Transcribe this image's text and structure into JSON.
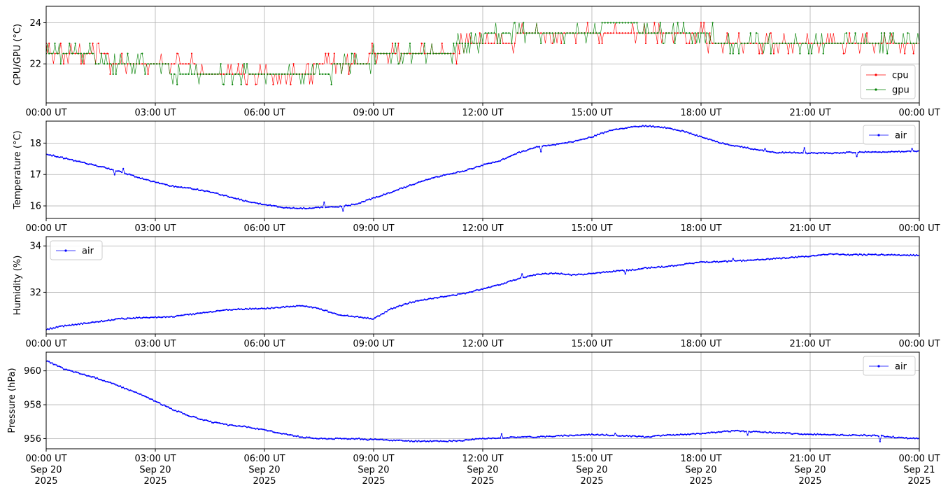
{
  "chart_data": [
    {
      "type": "line",
      "ylabel": "CPU/GPU (°C)",
      "ylim": [
        20.1,
        24.8
      ],
      "yticks": [
        22,
        24
      ],
      "xticks": [
        "00:00 UT",
        "03:00 UT",
        "06:00 UT",
        "09:00 UT",
        "12:00 UT",
        "15:00 UT",
        "18:00 UT",
        "21:00 UT",
        "00:00 UT"
      ],
      "grid": true,
      "legend": "bottom-right",
      "series": [
        {
          "name": "cpu",
          "color": "#ff0000",
          "x_hours": [
            0,
            0.5,
            1,
            1.5,
            2,
            2.5,
            3,
            3.5,
            4,
            4.5,
            5,
            5.5,
            6,
            6.5,
            7,
            7.5,
            8,
            8.5,
            9,
            9.5,
            10,
            10.5,
            11,
            11.5,
            12,
            12.5,
            13,
            13.5,
            14,
            14.5,
            15,
            15.5,
            16,
            16.5,
            17,
            17.5,
            18,
            18.5,
            19,
            19.5,
            20,
            20.5,
            21,
            21.5,
            22,
            22.5,
            23,
            23.5,
            24
          ],
          "values": [
            22.9,
            22.4,
            22.4,
            22.4,
            22.0,
            22.0,
            21.9,
            21.9,
            21.9,
            21.4,
            21.4,
            21.4,
            21.4,
            21.4,
            21.4,
            21.9,
            21.9,
            21.9,
            22.4,
            22.4,
            22.4,
            22.4,
            22.4,
            22.9,
            23.0,
            23.0,
            23.3,
            23.5,
            23.5,
            23.6,
            23.6,
            23.6,
            23.6,
            23.6,
            23.6,
            23.6,
            23.4,
            23.0,
            23.0,
            22.9,
            22.9,
            22.9,
            22.9,
            22.9,
            22.9,
            22.9,
            22.9,
            22.9,
            23.0
          ]
        },
        {
          "name": "gpu",
          "color": "#008000",
          "x_hours": [
            0,
            0.5,
            1,
            1.5,
            2,
            2.5,
            3,
            3.5,
            4,
            4.5,
            5,
            5.5,
            6,
            6.5,
            7,
            7.5,
            8,
            8.5,
            9,
            9.5,
            10,
            10.5,
            11,
            11.5,
            12,
            12.5,
            13,
            13.5,
            14,
            14.5,
            15,
            15.5,
            16,
            16.5,
            17,
            17.5,
            18,
            18.5,
            19,
            19.5,
            20,
            20.5,
            21,
            21.5,
            22,
            22.5,
            23,
            23.5,
            24
          ],
          "values": [
            22.7,
            22.4,
            22.3,
            22.2,
            22.1,
            22.0,
            21.9,
            21.7,
            21.5,
            21.4,
            21.4,
            21.4,
            21.4,
            21.4,
            21.4,
            21.6,
            21.8,
            21.9,
            22.3,
            22.4,
            22.4,
            22.4,
            22.6,
            22.9,
            23.3,
            23.4,
            23.5,
            23.5,
            23.6,
            23.6,
            23.7,
            23.8,
            23.8,
            23.7,
            23.6,
            23.6,
            23.4,
            23.2,
            23.1,
            23.0,
            23.0,
            23.0,
            23.0,
            23.0,
            23.0,
            23.0,
            23.0,
            23.0,
            23.1
          ]
        }
      ]
    },
    {
      "type": "line",
      "ylabel": "Temperature (°C)",
      "ylim": [
        15.6,
        18.7
      ],
      "yticks": [
        16,
        17,
        18
      ],
      "xticks": [
        "00:00 UT",
        "03:00 UT",
        "06:00 UT",
        "09:00 UT",
        "12:00 UT",
        "15:00 UT",
        "18:00 UT",
        "21:00 UT",
        "00:00 UT"
      ],
      "grid": true,
      "legend": "top-right",
      "series": [
        {
          "name": "air",
          "color": "#0000ff",
          "x_hours": [
            0,
            0.5,
            1,
            1.5,
            2,
            2.5,
            3,
            3.5,
            4,
            4.5,
            5,
            5.5,
            6,
            6.5,
            7,
            7.5,
            8,
            8.5,
            9,
            9.5,
            10,
            10.5,
            11,
            11.5,
            12,
            12.5,
            13,
            13.5,
            14,
            14.5,
            15,
            15.5,
            16,
            16.5,
            17,
            17.5,
            18,
            18.5,
            19,
            19.5,
            20,
            20.5,
            21,
            21.5,
            22,
            22.5,
            23,
            23.5,
            24
          ],
          "values": [
            17.65,
            17.52,
            17.38,
            17.25,
            17.1,
            16.92,
            16.75,
            16.62,
            16.55,
            16.45,
            16.3,
            16.15,
            16.05,
            15.95,
            15.92,
            15.95,
            15.97,
            16.05,
            16.25,
            16.45,
            16.65,
            16.85,
            17.0,
            17.12,
            17.3,
            17.45,
            17.7,
            17.88,
            17.95,
            18.05,
            18.2,
            18.4,
            18.5,
            18.55,
            18.5,
            18.38,
            18.2,
            18.02,
            17.9,
            17.8,
            17.7,
            17.7,
            17.68,
            17.68,
            17.7,
            17.72,
            17.72,
            17.73,
            17.75
          ]
        }
      ]
    },
    {
      "type": "line",
      "ylabel": "Humidity (%)",
      "ylim": [
        30.2,
        34.4
      ],
      "yticks": [
        32,
        34
      ],
      "xticks": [
        "00:00 UT",
        "03:00 UT",
        "06:00 UT",
        "09:00 UT",
        "12:00 UT",
        "15:00 UT",
        "18:00 UT",
        "21:00 UT",
        "00:00 UT"
      ],
      "grid": true,
      "legend": "top-left",
      "series": [
        {
          "name": "air",
          "color": "#0000ff",
          "x_hours": [
            0,
            0.5,
            1,
            1.5,
            2,
            2.5,
            3,
            3.5,
            4,
            4.5,
            5,
            5.5,
            6,
            6.5,
            7,
            7.5,
            8,
            8.5,
            9,
            9.5,
            10,
            10.5,
            11,
            11.5,
            12,
            12.5,
            13,
            13.5,
            14,
            14.5,
            15,
            15.5,
            16,
            16.5,
            17,
            17.5,
            18,
            18.5,
            19,
            19.5,
            20,
            20.5,
            21,
            21.5,
            22,
            22.5,
            23,
            23.5,
            24
          ],
          "values": [
            30.4,
            30.55,
            30.65,
            30.75,
            30.85,
            30.9,
            30.92,
            30.95,
            31.05,
            31.15,
            31.25,
            31.28,
            31.3,
            31.35,
            31.42,
            31.3,
            31.05,
            30.95,
            30.85,
            31.3,
            31.55,
            31.72,
            31.82,
            31.95,
            32.15,
            32.35,
            32.6,
            32.78,
            32.82,
            32.75,
            32.8,
            32.9,
            32.95,
            33.05,
            33.1,
            33.2,
            33.3,
            33.32,
            33.35,
            33.4,
            33.45,
            33.5,
            33.55,
            33.65,
            33.62,
            33.62,
            33.62,
            33.6,
            33.6
          ]
        }
      ]
    },
    {
      "type": "line",
      "ylabel": "Pressure (hPa)",
      "ylim": [
        955.4,
        961.1
      ],
      "yticks": [
        956,
        958,
        960
      ],
      "xticks": [
        "00:00 UT\nSep 20\n2025",
        "03:00 UT\nSep 20\n2025",
        "06:00 UT\nSep 20\n2025",
        "09:00 UT\nSep 20\n2025",
        "12:00 UT\nSep 20\n2025",
        "15:00 UT\nSep 20\n2025",
        "18:00 UT\nSep 20\n2025",
        "21:00 UT\nSep 20\n2025",
        "00:00 UT\nSep 21\n2025"
      ],
      "grid": true,
      "legend": "top-right",
      "series": [
        {
          "name": "air",
          "color": "#0000ff",
          "x_hours": [
            0,
            0.5,
            1,
            1.5,
            2,
            2.5,
            3,
            3.5,
            4,
            4.5,
            5,
            5.5,
            6,
            6.5,
            7,
            7.5,
            8,
            8.5,
            9,
            9.5,
            10,
            10.5,
            11,
            11.5,
            12,
            12.5,
            13,
            13.5,
            14,
            14.5,
            15,
            15.5,
            16,
            16.5,
            17,
            17.5,
            18,
            18.5,
            19,
            19.5,
            20,
            20.5,
            21,
            21.5,
            22,
            22.5,
            23,
            23.5,
            24
          ],
          "values": [
            960.6,
            960.1,
            959.8,
            959.5,
            959.1,
            958.7,
            958.2,
            957.7,
            957.3,
            957.0,
            956.8,
            956.7,
            956.5,
            956.3,
            956.1,
            956.0,
            956.0,
            956.0,
            955.95,
            955.9,
            955.85,
            955.85,
            955.85,
            955.9,
            956.0,
            956.05,
            956.1,
            956.1,
            956.15,
            956.2,
            956.25,
            956.2,
            956.15,
            956.1,
            956.2,
            956.25,
            956.3,
            956.4,
            956.45,
            956.4,
            956.35,
            956.3,
            956.25,
            956.25,
            956.2,
            956.2,
            956.15,
            956.05,
            956.0
          ]
        }
      ]
    }
  ]
}
